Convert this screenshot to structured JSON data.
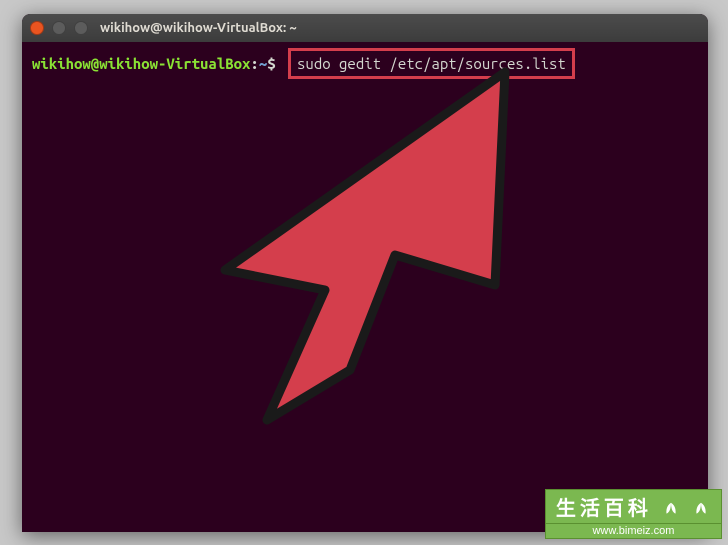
{
  "titlebar": {
    "title": "wikihow@wikihow-VirtualBox: ~"
  },
  "prompt": {
    "user_host": "wikihow@wikihow-VirtualBox",
    "colon": ":",
    "path": "~",
    "dollar": "$"
  },
  "command": {
    "text": "sudo gedit /etc/apt/sources.list"
  },
  "watermark": {
    "title": "生活百科",
    "url": "www.bimeiz.com"
  },
  "colors": {
    "terminal_bg": "#2c001e",
    "prompt_green": "#8ae234",
    "prompt_blue": "#729fcf",
    "highlight_red": "#d43e4c",
    "arrow_red": "#d43e4c"
  }
}
